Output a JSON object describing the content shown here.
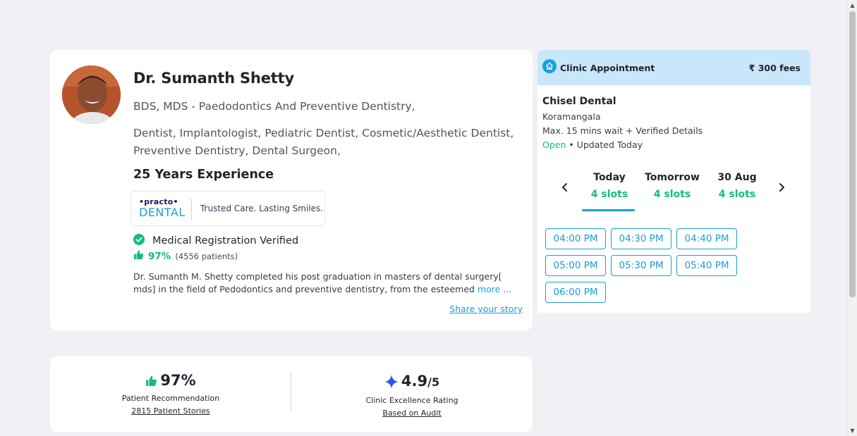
{
  "doctor": {
    "name": "Dr. Sumanth Shetty",
    "qualifications": "BDS, MDS - Paedodontics And Preventive Dentistry,",
    "specialties": "Dentist, Implantologist, Pediatric Dentist, Cosmetic/Aesthetic Dentist, Preventive Dentistry, Dental Surgeon,",
    "experience": "25 Years Experience",
    "badge": {
      "brand_top": "•practo•",
      "brand_bottom": "DENTAL",
      "tagline": "Trusted Care. Lasting Smiles."
    },
    "verified_label": "Medical Registration Verified",
    "recommendation_pct": "97%",
    "recommendation_patients": "(4556 patients)",
    "bio": "Dr. Sumanth M. Shetty completed his post graduation in masters of dental surgery[ mds] in the field of Pedodontics and preventive dentistry, from the esteemed",
    "bio_more": "more ...",
    "share_story": "Share your story"
  },
  "appointment": {
    "title": "Clinic Appointment",
    "fees": "₹ 300 fees",
    "clinic_name": "Chisel Dental",
    "clinic_location": "Koramangala",
    "clinic_wait": "Max. 15 mins wait + Verified Details",
    "status_open": "Open",
    "status_updated": " • Updated Today",
    "days": [
      {
        "label": "Today",
        "slots": "4 slots"
      },
      {
        "label": "Tomorrow",
        "slots": "4 slots"
      },
      {
        "label": "30 Aug",
        "slots": "4 slots"
      }
    ],
    "time_slots": [
      "04:00 PM",
      "04:30 PM",
      "04:40 PM",
      "05:00 PM",
      "05:30 PM",
      "05:40 PM",
      "06:00 PM"
    ]
  },
  "stats": {
    "recommendation_value": "97%",
    "recommendation_label": "Patient Recommendation",
    "recommendation_link": "2815 Patient Stories",
    "rating_value": "4.9",
    "rating_denom": "/5",
    "rating_label": "Clinic Excellence Rating",
    "rating_link": "Based on Audit"
  },
  "colors": {
    "accent": "#199fd9",
    "green": "#14bd7a",
    "header_bg": "#c8e7fa",
    "page_bg": "#f0f0f5"
  },
  "icons": {
    "clinic": "home-icon",
    "verified": "check-circle-icon",
    "thumbs_up": "thumbs-up-icon",
    "rating": "sparkle-star-icon",
    "prev": "chevron-left-icon",
    "next": "chevron-right-icon"
  }
}
